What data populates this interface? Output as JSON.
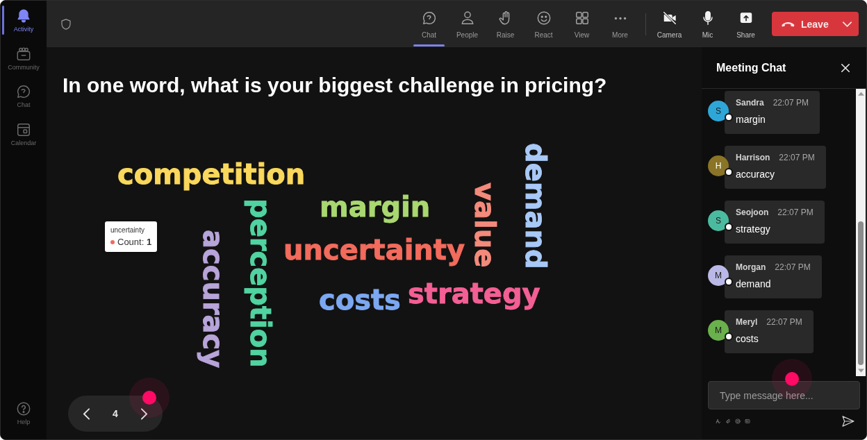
{
  "sidebar": {
    "items": [
      {
        "label": "Activity",
        "selected": true
      },
      {
        "label": "Community",
        "selected": false
      },
      {
        "label": "Chat",
        "selected": false
      },
      {
        "label": "Calendar",
        "selected": false
      }
    ],
    "help": {
      "label": "Help"
    }
  },
  "top_bar": {
    "tabs": [
      {
        "label": "Chat",
        "selected": true
      },
      {
        "label": "People",
        "selected": false
      },
      {
        "label": "Raise",
        "selected": false
      },
      {
        "label": "React",
        "selected": false
      },
      {
        "label": "View",
        "selected": false
      },
      {
        "label": "More",
        "selected": false
      }
    ],
    "controls": [
      {
        "label": "Camera"
      },
      {
        "label": "Mic"
      },
      {
        "label": "Share"
      }
    ],
    "leave_button": {
      "label": "Leave"
    }
  },
  "question": {
    "title": "In one word, what is your biggest challenge in pricing?"
  },
  "word_cloud": {
    "words": [
      {
        "text": "demand",
        "color": "#a8c9f7",
        "vertical": true
      },
      {
        "text": "competition",
        "color": "#fad85c",
        "vertical": false
      },
      {
        "text": "value",
        "color": "#f48a7b",
        "vertical": true
      },
      {
        "text": "margin",
        "color": "#a9d770",
        "vertical": false
      },
      {
        "text": "perception",
        "color": "#50d3a0",
        "vertical": true
      },
      {
        "text": "accuracy",
        "color": "#b7a4d9",
        "vertical": true
      },
      {
        "text": "uncertainty",
        "color": "#f26b5c",
        "vertical": false
      },
      {
        "text": "strategy",
        "color": "#f35f94",
        "vertical": false
      },
      {
        "text": "costs",
        "color": "#7ca8f1",
        "vertical": false
      }
    ],
    "tooltip": {
      "title": "uncertainty",
      "label": "Count:",
      "value": "1"
    }
  },
  "pager": {
    "page": "4"
  },
  "chat_panel": {
    "title": "Meeting Chat",
    "messages": [
      {
        "author": "Sandra",
        "initial": "S",
        "color": "#2ea7d8",
        "time": "22:07 PM",
        "text": "margin"
      },
      {
        "author": "Harrison",
        "initial": "H",
        "color": "#8a7426",
        "time": "22:07 PM",
        "text": "accuracy"
      },
      {
        "author": "Seojoon",
        "initial": "S",
        "color": "#4bbba0",
        "time": "22:07 PM",
        "text": "strategy"
      },
      {
        "author": "Morgan",
        "initial": "M",
        "color": "#b9b8e6",
        "time": "22:07 PM",
        "text": "demand"
      },
      {
        "author": "Meryl",
        "initial": "M",
        "color": "#6ab04c",
        "time": "22:07 PM",
        "text": "costs"
      }
    ],
    "composer": {
      "placeholder": "Type message here..."
    }
  }
}
